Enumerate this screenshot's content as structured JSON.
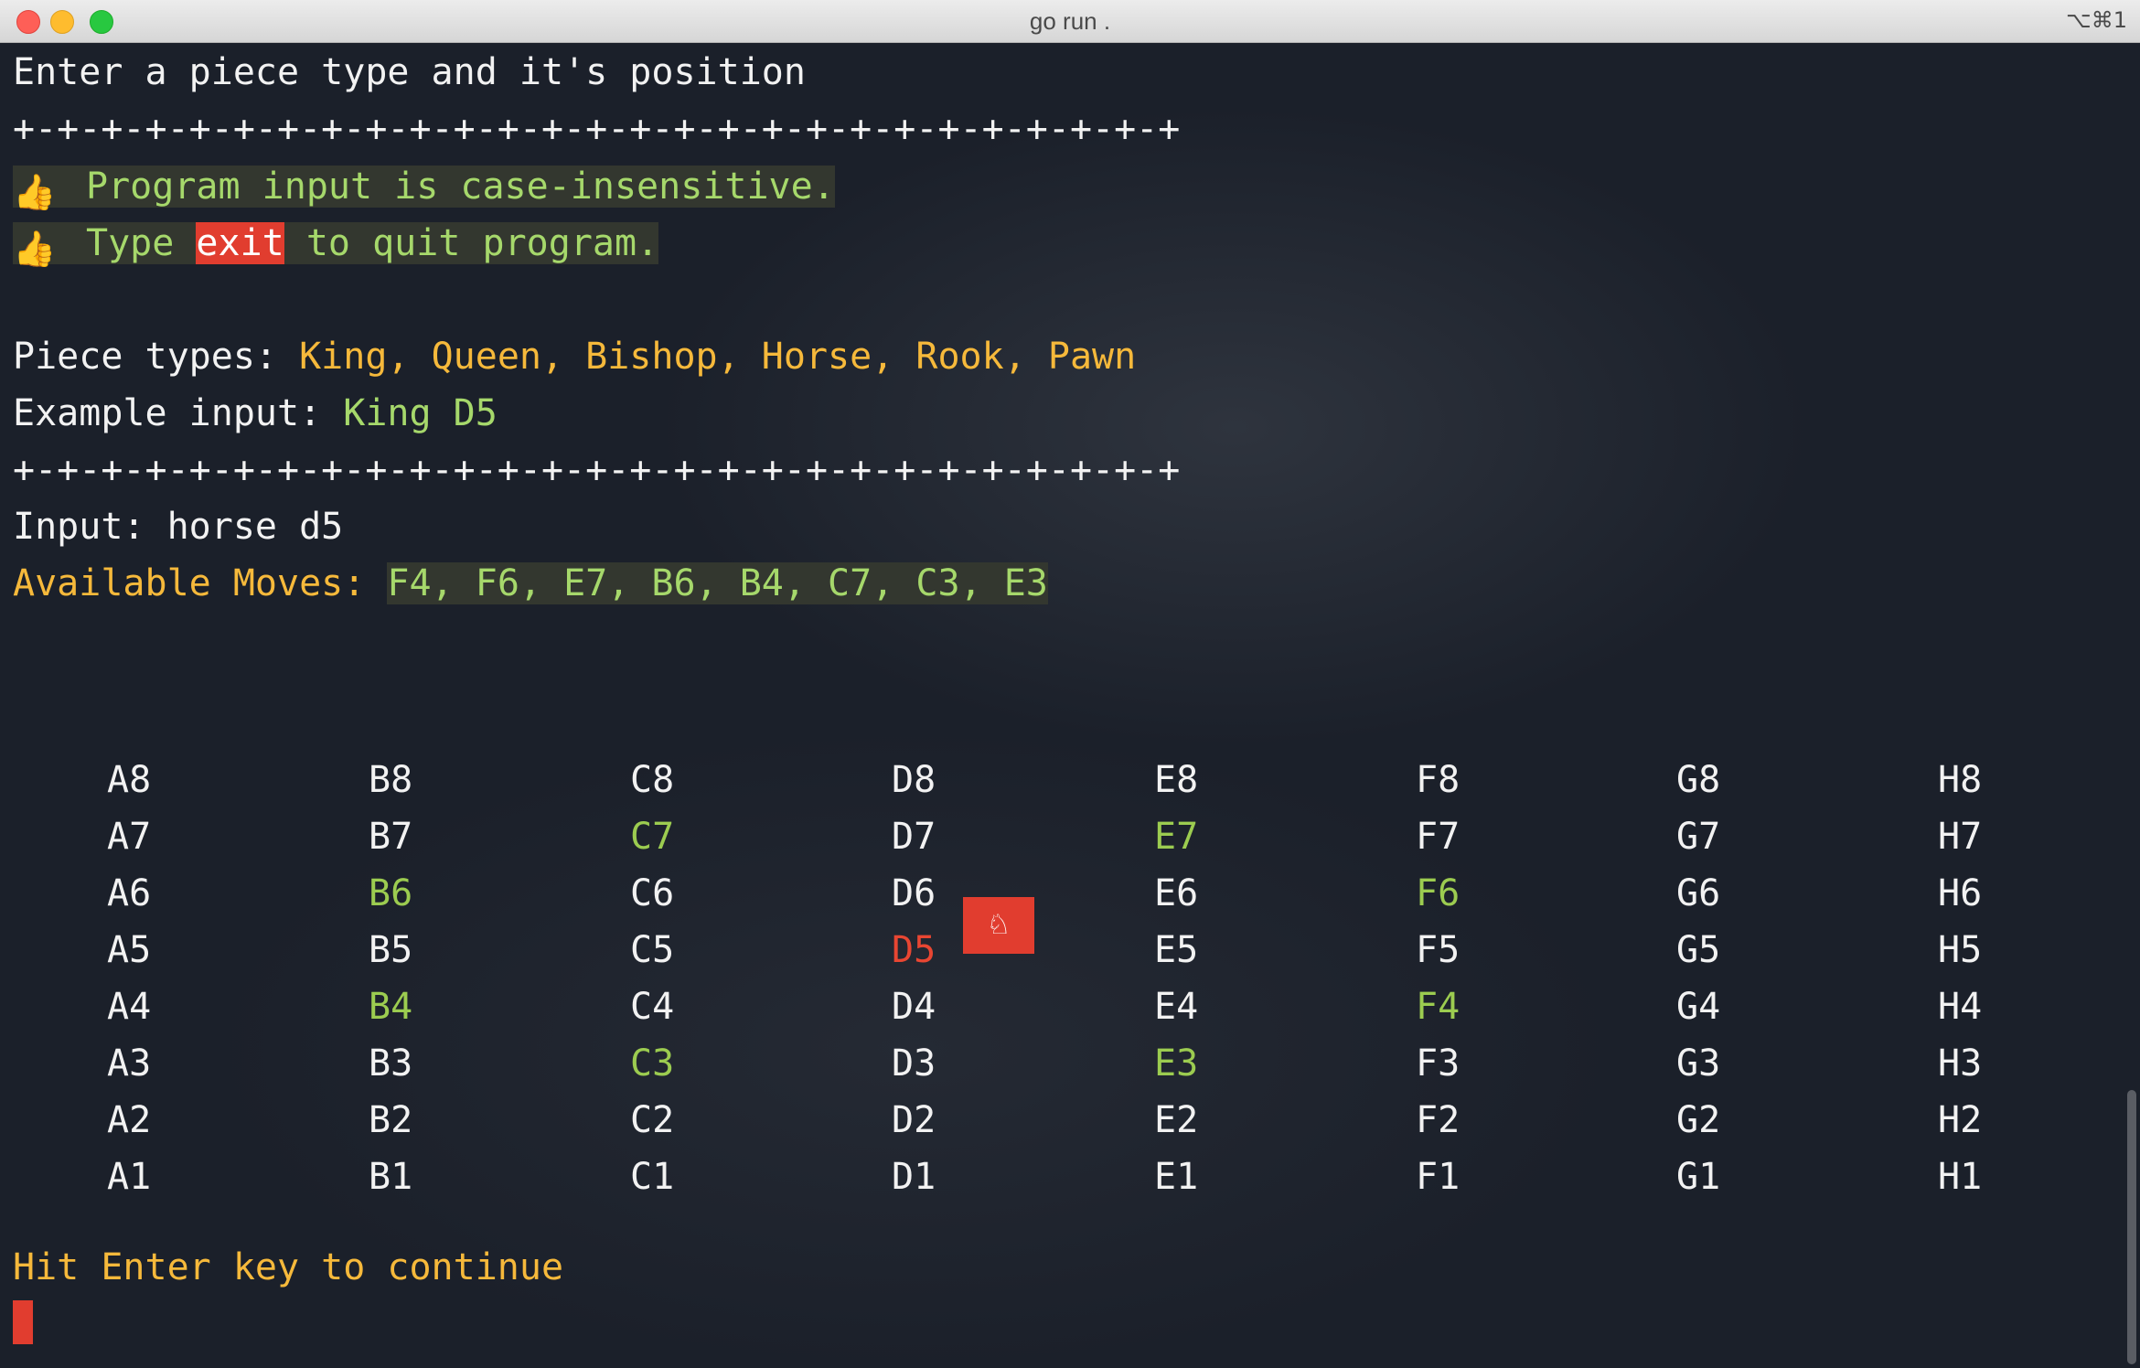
{
  "window": {
    "title": "go run .",
    "shortcut": "⌥⌘1"
  },
  "terminal": {
    "prompt_line": "Enter a piece type and it's position",
    "separator": "+-+-+-+-+-+-+-+-+-+-+-+-+-+-+-+-+-+-+-+-+-+-+-+-+-+-+",
    "tips": {
      "icon": "thumbs-up-icon",
      "line1": "Program input is case-insensitive.",
      "line2_prefix": "Type ",
      "line2_keyword": "exit",
      "line2_suffix": " to quit program."
    },
    "piece_types_label": "Piece types: ",
    "piece_types_value": "King, Queen, Bishop, Horse, Rook, Pawn",
    "example_label": "Example input: ",
    "example_value": "King D5",
    "input_label": "Input: ",
    "input_value": "horse d5",
    "moves_label": "Available Moves: ",
    "moves_value": "F4, F6, E7, B6, B4, C7, C3, E3",
    "continue_text": "Hit Enter key to continue",
    "piece_glyph": "♘"
  },
  "board": {
    "files": [
      "A",
      "B",
      "C",
      "D",
      "E",
      "F",
      "G",
      "H"
    ],
    "ranks": [
      "8",
      "7",
      "6",
      "5",
      "4",
      "3",
      "2",
      "1"
    ],
    "current": "D5",
    "moves": [
      "F4",
      "F6",
      "E7",
      "B6",
      "B4",
      "C7",
      "C3",
      "E3"
    ]
  },
  "colors": {
    "background": "#1b202a",
    "text": "#f2f2f2",
    "yellow": "#f6b93b",
    "green": "#a6d86b",
    "red": "#e13d2f"
  }
}
